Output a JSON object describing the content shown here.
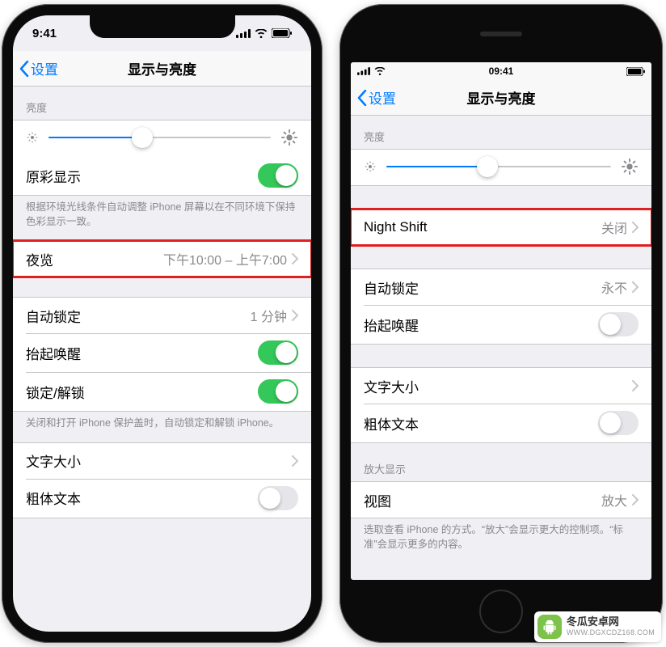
{
  "left": {
    "status_time": "9:41",
    "back_label": "设置",
    "page_title": "显示与亮度",
    "brightness": {
      "header": "亮度",
      "value_pct": 42
    },
    "true_tone": {
      "label": "原彩显示",
      "on": true
    },
    "true_tone_footer": "根据环境光线条件自动调整 iPhone 屏幕以在不同环境下保持色彩显示一致。",
    "night_shift": {
      "label": "夜览",
      "value": "下午10:00 – 上午7:00"
    },
    "auto_lock": {
      "label": "自动锁定",
      "value": "1 分钟"
    },
    "raise_to_wake": {
      "label": "抬起唤醒",
      "on": true
    },
    "lock_unlock": {
      "label": "锁定/解锁",
      "on": true
    },
    "lock_footer": "关闭和打开 iPhone 保护盖时，自动锁定和解锁 iPhone。",
    "text_size": {
      "label": "文字大小"
    },
    "bold_text": {
      "label": "粗体文本",
      "on": false
    }
  },
  "right": {
    "status_time": "09:41",
    "back_label": "设置",
    "page_title": "显示与亮度",
    "brightness": {
      "header": "亮度",
      "value_pct": 45
    },
    "night_shift": {
      "label": "Night Shift",
      "value": "关闭"
    },
    "auto_lock": {
      "label": "自动锁定",
      "value": "永不"
    },
    "raise_to_wake": {
      "label": "抬起唤醒",
      "on": false
    },
    "text_size": {
      "label": "文字大小"
    },
    "bold_text": {
      "label": "粗体文本",
      "on": false
    },
    "zoom": {
      "header": "放大显示",
      "label": "视图",
      "value": "放大"
    },
    "zoom_footer": "选取查看 iPhone 的方式。“放大”会显示更大的控制项。“标准”会显示更多的内容。"
  },
  "watermark": {
    "l1": "冬瓜安卓网",
    "l2": "WWW.DGXCDZ168.COM"
  }
}
